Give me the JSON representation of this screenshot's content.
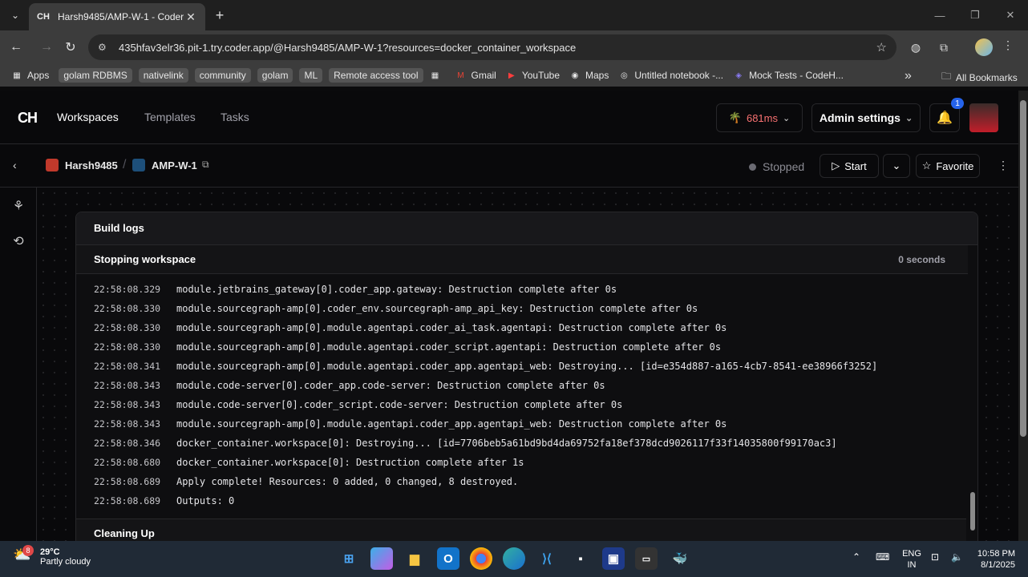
{
  "browser": {
    "tab_title": "Harsh9485/AMP-W-1 - Coder",
    "url": "435hfav3elr36.pit-1.try.coder.app/@Harsh9485/AMP-W-1?resources=docker_container_workspace",
    "bookmarks": [
      {
        "label": "Apps",
        "icon": "apps-grid-icon",
        "chip": false
      },
      {
        "label": "golam RDBMS",
        "chip": true
      },
      {
        "label": "nativelink",
        "chip": true
      },
      {
        "label": "community",
        "chip": true
      },
      {
        "label": "golam",
        "chip": true
      },
      {
        "label": "ML",
        "chip": true
      },
      {
        "label": "Remote access tool",
        "chip": true
      },
      {
        "label": "",
        "icon": "tab-groups-icon",
        "chip": false
      },
      {
        "label": "Gmail",
        "icon": "gmail-icon",
        "chip": false
      },
      {
        "label": "YouTube",
        "icon": "youtube-icon",
        "chip": false
      },
      {
        "label": "Maps",
        "icon": "maps-icon",
        "chip": false
      },
      {
        "label": "Untitled notebook -...",
        "icon": "notebook-icon",
        "chip": false
      },
      {
        "label": "Mock Tests - CodeH...",
        "icon": "codeh-icon",
        "chip": false
      }
    ],
    "all_bookmarks": "All Bookmarks"
  },
  "nav": {
    "logo": "CH",
    "links": [
      "Workspaces",
      "Templates",
      "Tasks"
    ],
    "latency": "681ms",
    "admin_settings": "Admin settings",
    "notifications_count": "1"
  },
  "workspace": {
    "owner": "Harsh9485",
    "name": "AMP-W-1",
    "status": "Stopped",
    "start": "Start",
    "favorite": "Favorite"
  },
  "build_logs": {
    "title": "Build logs",
    "stage": "Stopping workspace",
    "stage_duration": "0 seconds",
    "next_stage": "Cleaning Up",
    "lines": [
      {
        "ts": "22:58:08.329",
        "msg": "module.jetbrains_gateway[0].coder_app.gateway: Destruction complete after 0s"
      },
      {
        "ts": "22:58:08.330",
        "msg": "module.sourcegraph-amp[0].coder_env.sourcegraph-amp_api_key: Destruction complete after 0s"
      },
      {
        "ts": "22:58:08.330",
        "msg": "module.sourcegraph-amp[0].module.agentapi.coder_ai_task.agentapi: Destruction complete after 0s"
      },
      {
        "ts": "22:58:08.330",
        "msg": "module.sourcegraph-amp[0].module.agentapi.coder_script.agentapi: Destruction complete after 0s"
      },
      {
        "ts": "22:58:08.341",
        "msg": "module.sourcegraph-amp[0].module.agentapi.coder_app.agentapi_web: Destroying... [id=e354d887-a165-4cb7-8541-ee38966f3252]"
      },
      {
        "ts": "22:58:08.343",
        "msg": "module.code-server[0].coder_app.code-server: Destruction complete after 0s"
      },
      {
        "ts": "22:58:08.343",
        "msg": "module.code-server[0].coder_script.code-server: Destruction complete after 0s"
      },
      {
        "ts": "22:58:08.343",
        "msg": "module.sourcegraph-amp[0].module.agentapi.coder_app.agentapi_web: Destruction complete after 0s"
      },
      {
        "ts": "22:58:08.346",
        "msg": "docker_container.workspace[0]: Destroying... [id=7706beb5a61bd9bd4da69752fa18ef378dcd9026117f33f14035800f99170ac3]"
      },
      {
        "ts": "22:58:08.680",
        "msg": "docker_container.workspace[0]: Destruction complete after 1s"
      },
      {
        "ts": "22:58:08.689",
        "msg": "Apply complete! Resources: 0 added, 0 changed, 8 destroyed."
      },
      {
        "ts": "22:58:08.689",
        "msg": "Outputs: 0"
      }
    ]
  },
  "taskbar": {
    "temperature": "29°C",
    "weather": "Partly cloudy",
    "weather_badge": "8",
    "lang_top": "ENG",
    "lang_bottom": "IN",
    "time": "10:58 PM",
    "date": "8/1/2025"
  }
}
